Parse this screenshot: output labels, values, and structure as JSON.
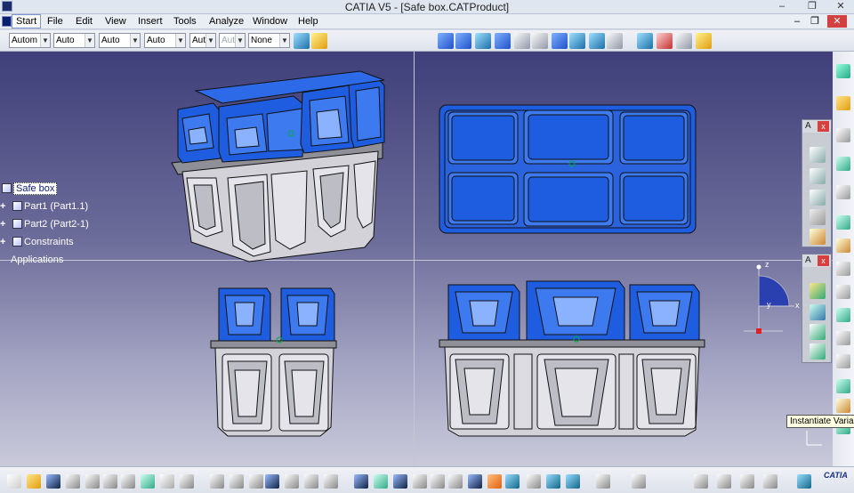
{
  "window": {
    "title": "CATIA V5 - [Safe box.CATProduct]",
    "minimize": "–",
    "restore": "❐",
    "close": "✕"
  },
  "menu": {
    "items": [
      "Start",
      "File",
      "Edit",
      "View",
      "Insert",
      "Tools",
      "Analyze",
      "Window",
      "Help"
    ],
    "doc_minimize": "–",
    "doc_restore": "❐",
    "doc_close": "✕"
  },
  "toolbar": {
    "dropdowns": [
      "Autom",
      "Auto",
      "Auto",
      "Auto",
      "Aut",
      "Aut",
      "None"
    ]
  },
  "tree": {
    "root": "Safe box",
    "items": [
      "Part1 (Part1.1)",
      "Part2 (Part2-1)",
      "Constraints",
      "Applications"
    ]
  },
  "compass": {
    "z": "z",
    "x": "x",
    "y": "y"
  },
  "panels": {
    "panel1_title": "A",
    "panel2_title": "A",
    "close": "x"
  },
  "tooltip": "Instantiate Variant",
  "bottombar": {
    "logo": "CATIA"
  },
  "colors": {
    "lid_blue": "#1f5de0",
    "body_gray": "#d2d2d8",
    "viewport_top": "#3f3f7a"
  },
  "icons": {
    "tree_root": "product-icon",
    "tree_part": "part-icon",
    "tree_constraints": "constraints-icon"
  }
}
